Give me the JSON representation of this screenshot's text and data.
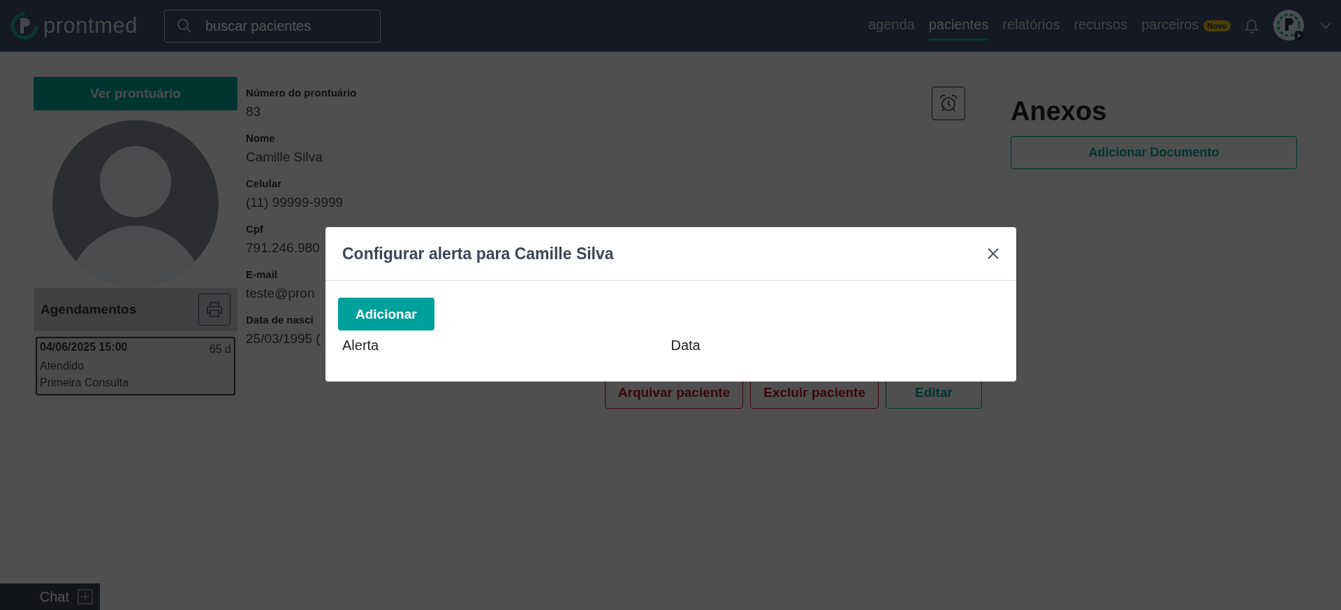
{
  "header": {
    "logo": "prontmed",
    "search": {
      "placeholder": "buscar pacientes"
    },
    "nav": [
      {
        "label": "agenda",
        "selected": false
      },
      {
        "label": "pacientes",
        "selected": true
      },
      {
        "label": "relatórios",
        "selected": false
      },
      {
        "label": "recursos",
        "selected": false
      },
      {
        "label": "parceiros",
        "selected": false,
        "badge": "Novo"
      }
    ]
  },
  "patient": {
    "open_record_button": "Ver prontuário",
    "fields": [
      {
        "label": "Número do prontuário",
        "value": "83"
      },
      {
        "label": "Nome",
        "value": "Camille Silva"
      },
      {
        "label": "Celular",
        "value": "(11) 99999-9999"
      },
      {
        "label": "Cpf",
        "value": "791.246.980"
      },
      {
        "label": "E-mail",
        "value": "teste@pron"
      },
      {
        "label": "Data de nasci",
        "value": "25/03/1995 ("
      }
    ],
    "actions": [
      {
        "label": "Arquivar paciente",
        "kind": "danger"
      },
      {
        "label": "Excluir paciente",
        "kind": "danger"
      },
      {
        "label": "Editar",
        "kind": "primary"
      }
    ]
  },
  "appointments": {
    "title": "Agendamentos",
    "items": [
      {
        "datetime": "04/06/2025 15:00",
        "ago": "65 d",
        "status": "Atendido",
        "type": "Primeira Consulta"
      }
    ]
  },
  "attachments": {
    "title": "Anexos",
    "add_button": "Adicionar Documento"
  },
  "modal": {
    "title": "Configurar alerta para Camille Silva",
    "add_button": "Adicionar",
    "columns": [
      "Alerta",
      "Data"
    ]
  },
  "chat": {
    "label": "Chat"
  }
}
